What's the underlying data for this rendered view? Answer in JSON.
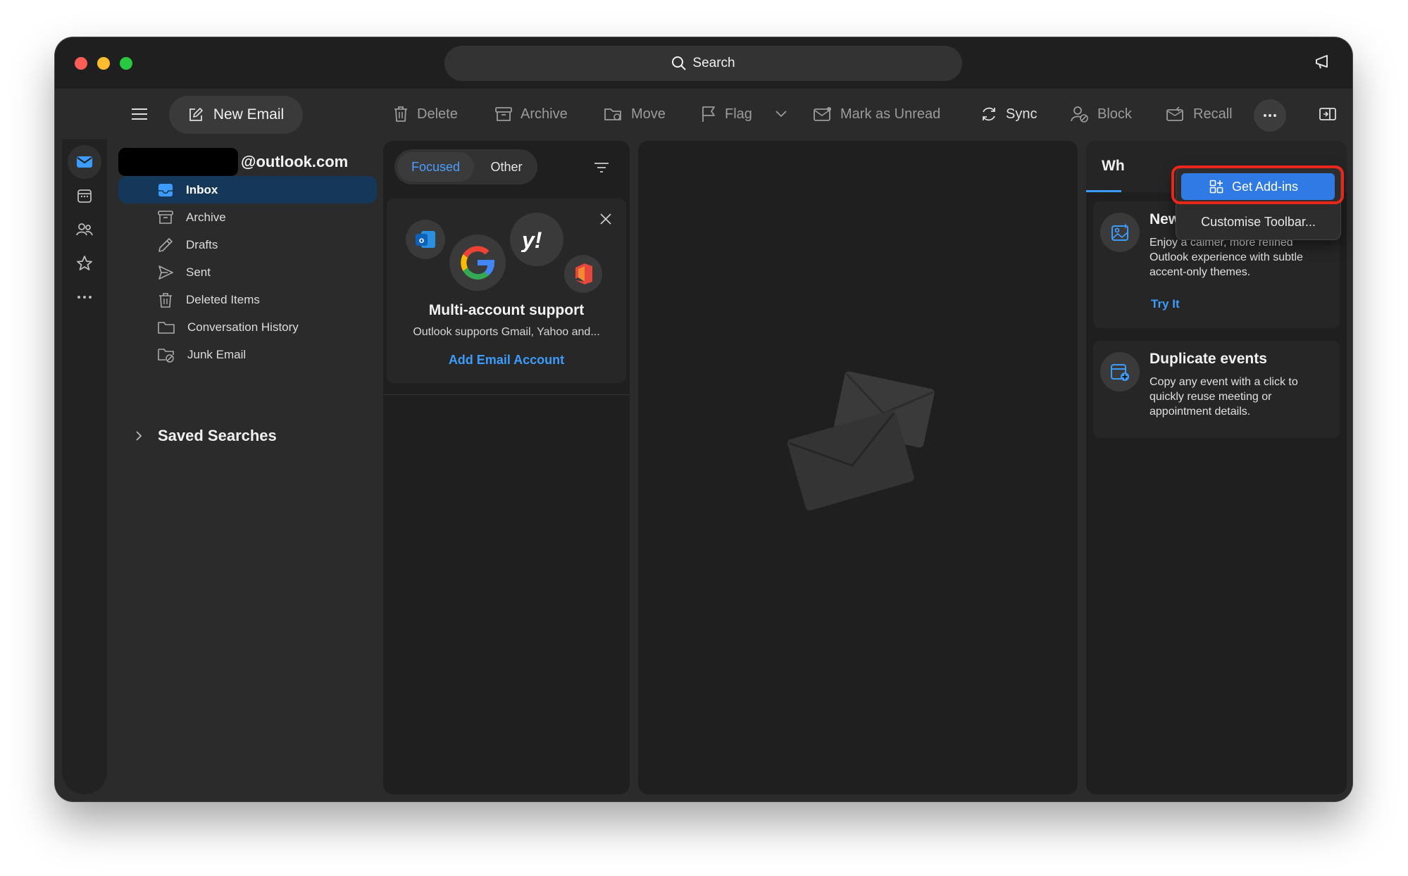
{
  "search": {
    "label": "Search"
  },
  "toolbar": {
    "new_email": "New Email",
    "delete": "Delete",
    "archive": "Archive",
    "move": "Move",
    "flag": "Flag",
    "mark_unread": "Mark as Unread",
    "sync": "Sync",
    "block": "Block",
    "recall": "Recall"
  },
  "account": {
    "email_suffix": "@outlook.com"
  },
  "folders": [
    {
      "label": "Inbox",
      "icon": "inbox-icon"
    },
    {
      "label": "Archive",
      "icon": "archive-icon"
    },
    {
      "label": "Drafts",
      "icon": "pencil-icon"
    },
    {
      "label": "Sent",
      "icon": "send-icon"
    },
    {
      "label": "Deleted Items",
      "icon": "trash-icon"
    },
    {
      "label": "Conversation History",
      "icon": "folder-icon"
    },
    {
      "label": "Junk Email",
      "icon": "junk-icon"
    }
  ],
  "saved_searches": "Saved Searches",
  "list": {
    "tabs": {
      "focused": "Focused",
      "other": "Other"
    },
    "card": {
      "title": "Multi-account support",
      "desc": "Outlook supports Gmail, Yahoo and...",
      "link": "Add Email Account"
    }
  },
  "right_pane": {
    "tab": "Wh",
    "tips": [
      {
        "title": "New Subtle Themes",
        "desc": "Enjoy a calmer, more refined Outlook experience with subtle accent-only themes.",
        "link": "Try It"
      },
      {
        "title": "Duplicate events",
        "desc": "Copy any event with a click to quickly reuse meeting or appointment details."
      }
    ]
  },
  "dropdown": {
    "get_addins": "Get Add-ins",
    "customise": "Customise Toolbar..."
  },
  "colors": {
    "accent": "#2f7ae5",
    "link": "#3c9bff",
    "highlight": "#e8261a"
  }
}
